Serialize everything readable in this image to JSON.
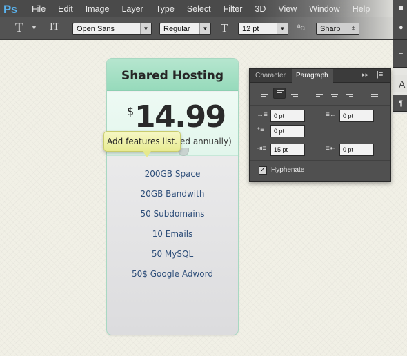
{
  "app": {
    "logo": "Ps"
  },
  "menu": [
    "File",
    "Edit",
    "Image",
    "Layer",
    "Type",
    "Select",
    "Filter",
    "3D",
    "View",
    "Window",
    "Help"
  ],
  "options_bar": {
    "tool_icon": "horizontal-type-tool",
    "orientation_icon": "toggle-text-orientation",
    "font_family": "Open Sans",
    "font_style": "Regular",
    "font_size": "12 pt",
    "antialias": "Sharp"
  },
  "card": {
    "title": "Shared Hosting",
    "currency": "$",
    "price": "14.99",
    "billing": "ed annually)",
    "features": [
      "200GB Space",
      "20GB Bandwith",
      "50 Subdomains",
      "10 Emails",
      "50 MySQL",
      "50$ Google Adword"
    ]
  },
  "tooltip": {
    "text": "Add features list."
  },
  "paragraph_panel": {
    "tabs": [
      "Character",
      "Paragraph"
    ],
    "active_tab": "Paragraph",
    "indent_left": "0 pt",
    "indent_right": "0 pt",
    "indent_first_line": "0 pt",
    "space_before": "15 pt",
    "space_after": "0 pt",
    "hyphenate_label": "Hyphenate",
    "hyphenate_checked": true
  },
  "colors": {
    "card_header": "#9ddcc0",
    "tooltip": "#eef0a8",
    "feature_text": "#2f4f7a",
    "ps_blue": "#5ab4f0"
  }
}
